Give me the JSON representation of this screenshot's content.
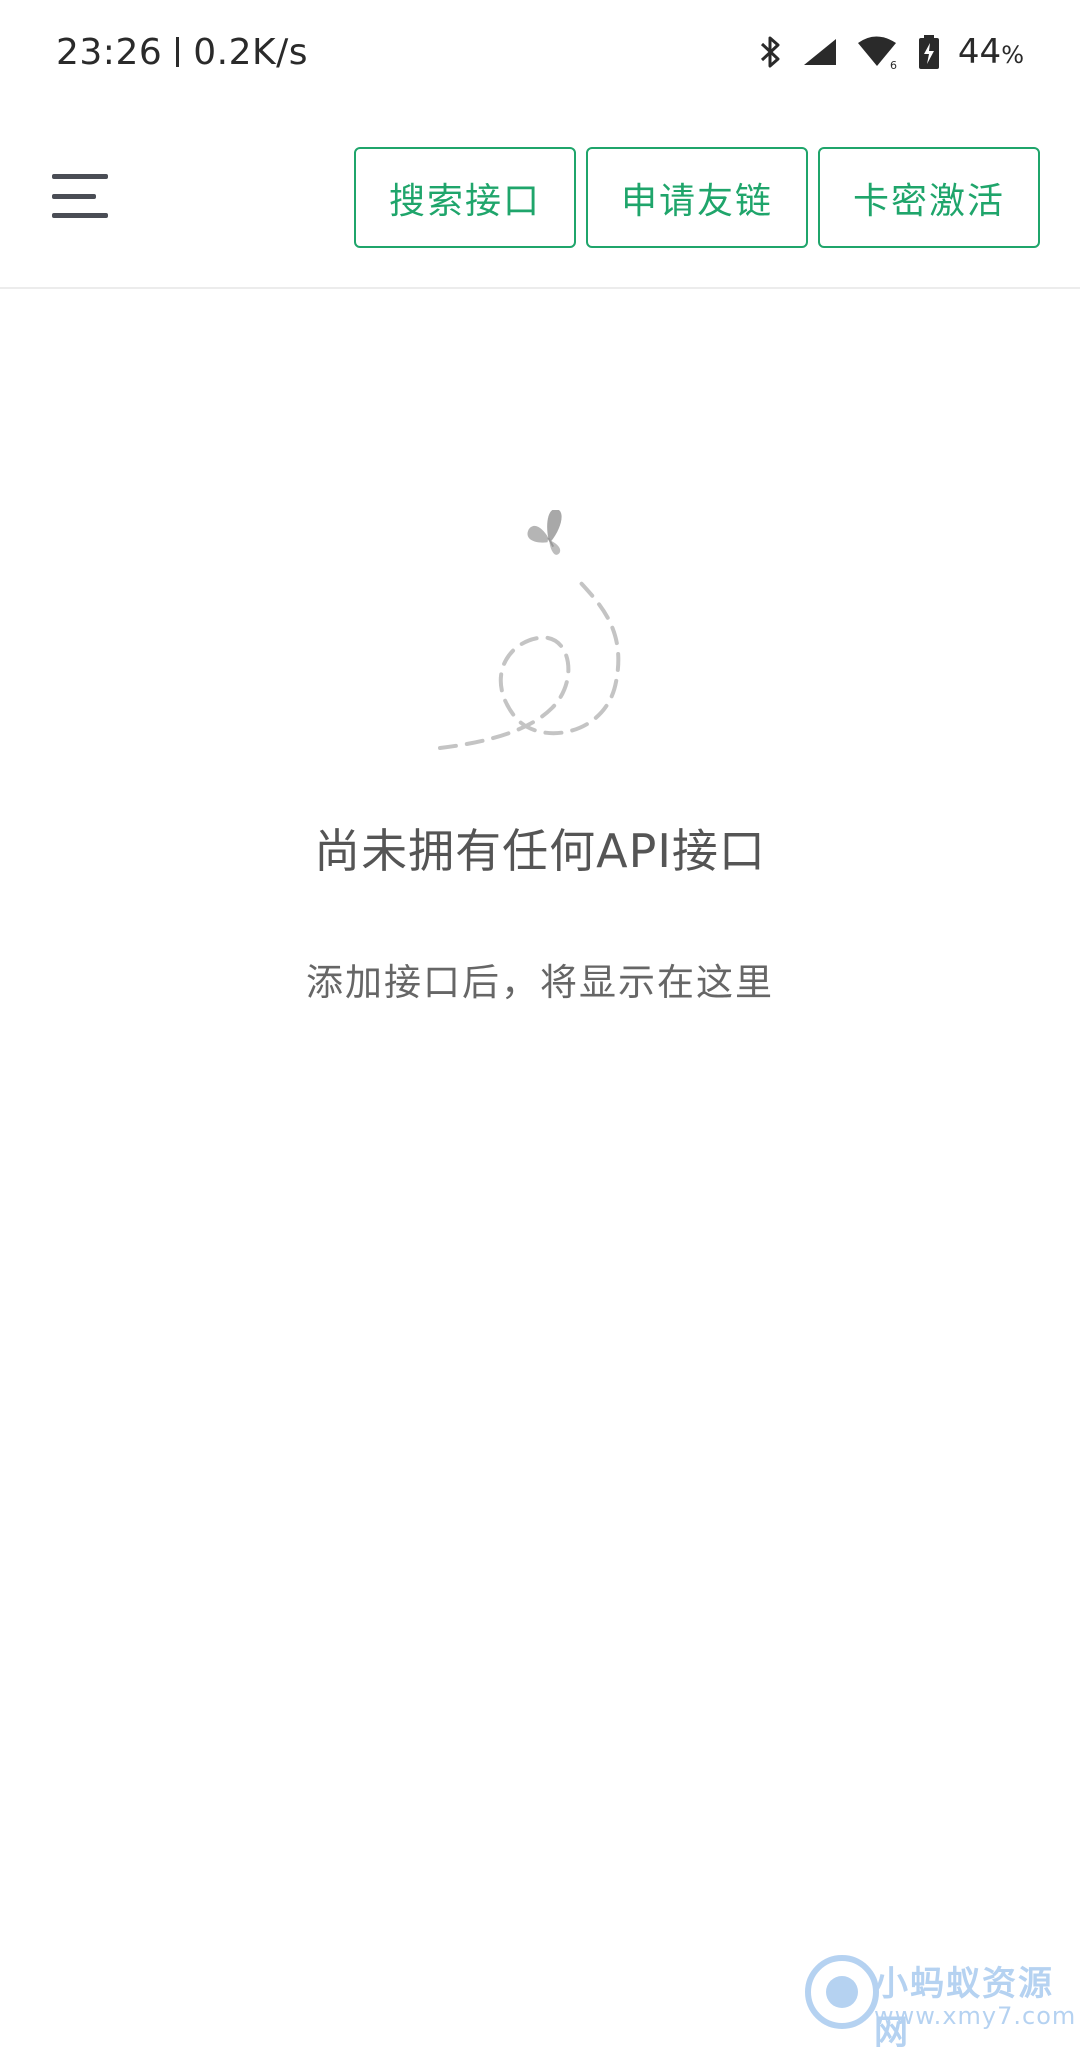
{
  "status_bar": {
    "time": "23:26",
    "network_speed": "0.2K/s",
    "battery_value": "44",
    "battery_unit": "%",
    "icons": [
      "bluetooth-icon",
      "cellular-signal-icon",
      "wifi-6-icon",
      "battery-charging-icon"
    ]
  },
  "header": {
    "menu_icon": "hamburger-menu-icon",
    "buttons": {
      "search_label": "搜索接口",
      "friend_link_label": "申请友链",
      "activate_label": "卡密激活"
    },
    "accent_color": "#1fa56b"
  },
  "empty_state": {
    "illustration": "butterfly-dashed-path-icon",
    "title": "尚未拥有任何API接口",
    "subtitle": "添加接口后，将显示在这里"
  },
  "watermark": {
    "text": "小蚂蚁资源网",
    "url": "www.xmy7.com"
  }
}
